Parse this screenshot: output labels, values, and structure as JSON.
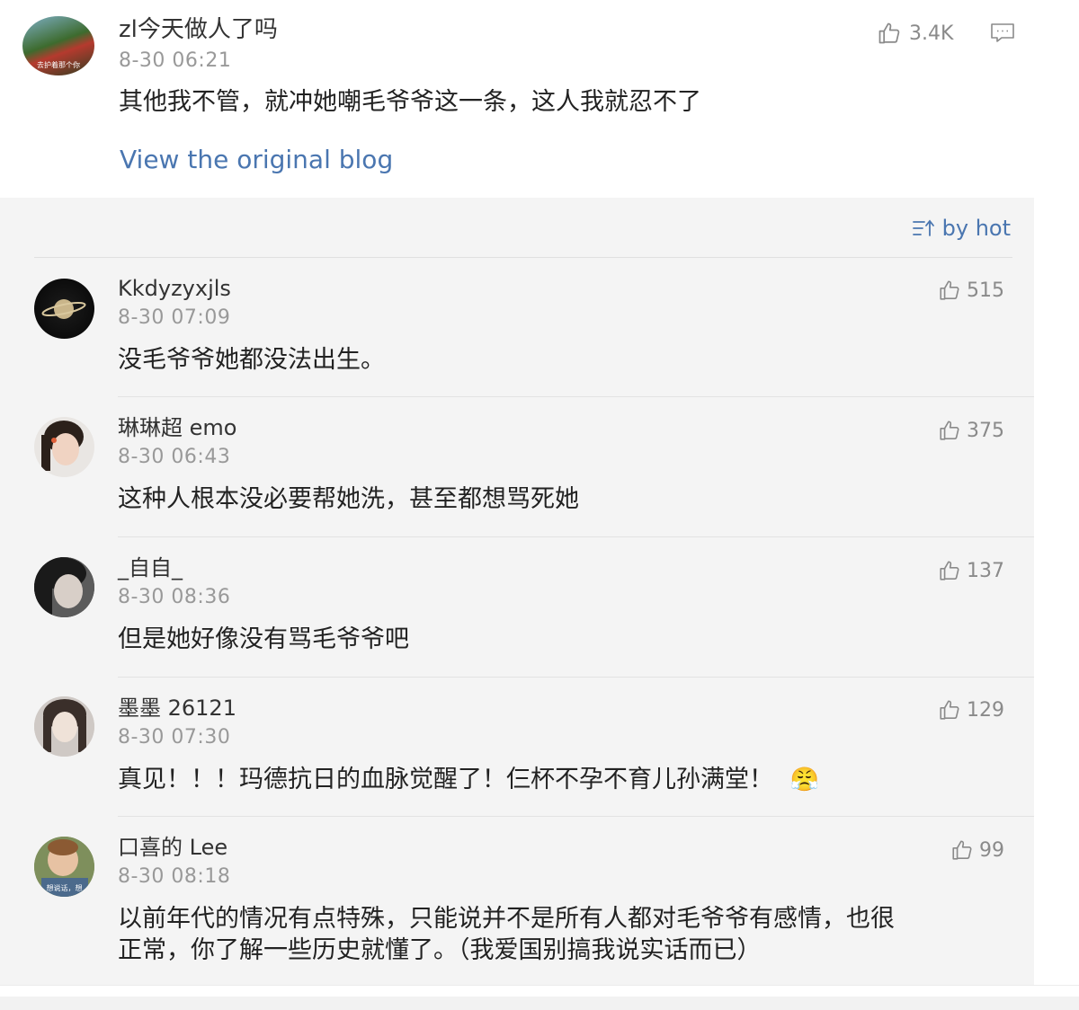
{
  "main_comment": {
    "username": "zl今天做人了吗",
    "avatar_caption": "去护着那个你",
    "time": "8-30 06:21",
    "text": "其他我不管，就冲她嘲毛爷爷这一条，这人我就忍不了",
    "likes": "3.4K",
    "view_original": "View the original blog"
  },
  "sort": {
    "label": "by hot"
  },
  "replies": [
    {
      "username": "Kkdyzyxjls",
      "time": "8-30 07:09",
      "text": "没毛爷爷她都没法出生。",
      "likes": "515"
    },
    {
      "username": "琳琳超 emo",
      "time": "8-30 06:43",
      "text": "这种人根本没必要帮她洗，甚至都想骂死她",
      "likes": "375"
    },
    {
      "username": "_自自_",
      "time": "8-30 08:36",
      "text": "但是她好像没有骂毛爷爷吧",
      "likes": "137"
    },
    {
      "username": "墨墨 26121",
      "time": "8-30 07:30",
      "text": "真见！！！玛德抗日的血脉觉醒了！仨杯不孕不育儿孙满堂！",
      "likes": "129",
      "emoji": "😤"
    },
    {
      "username": "口喜的 Lee",
      "avatar_caption": "想说话，想",
      "time": "8-30 08:18",
      "text_line1": "以前年代的情况有点特殊，只能说并不是所有人都对毛爷爷有感情，也很",
      "text_line2": "正常，你了解一些历史就懂了。（我爱国别搞我说实话而已）",
      "likes": "99"
    }
  ]
}
